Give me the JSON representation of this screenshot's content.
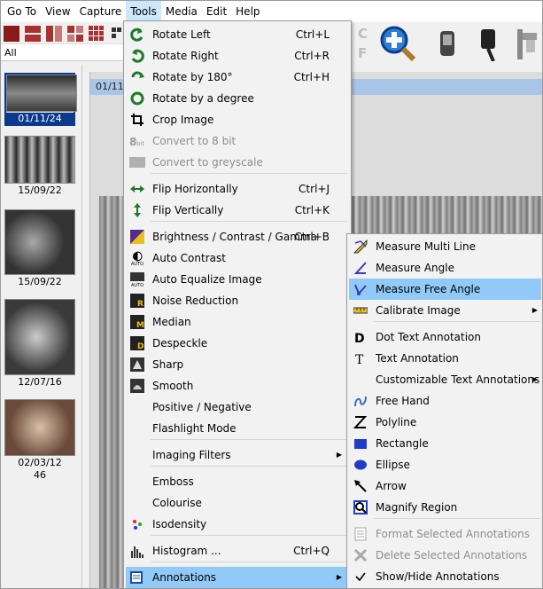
{
  "menubar": {
    "items": [
      {
        "label": "Go To"
      },
      {
        "label": "View"
      },
      {
        "label": "Capture"
      },
      {
        "label": "Tools"
      },
      {
        "label": "Media"
      },
      {
        "label": "Edit"
      },
      {
        "label": "Help"
      }
    ]
  },
  "toolbar": {
    "filter_value": "All",
    "cf_label_top": "C",
    "cf_label_bottom": "F"
  },
  "thumbnails": [
    {
      "label": "01/11/24",
      "selected": true
    },
    {
      "label": "15/09/22",
      "selected": false
    },
    {
      "label": "15/09/22",
      "selected": false
    },
    {
      "label": "12/07/16",
      "selected": false
    },
    {
      "label": "02/03/12",
      "extra": "46",
      "selected": false
    }
  ],
  "viewer": {
    "title": "01/11/"
  },
  "tools_menu": {
    "items": [
      {
        "label": "Rotate Left",
        "shortcut": "Ctrl+L",
        "icon": "rotate-left-icon"
      },
      {
        "label": "Rotate Right",
        "shortcut": "Ctrl+R",
        "icon": "rotate-right-icon"
      },
      {
        "label": "Rotate by 180°",
        "shortcut": "Ctrl+H",
        "icon": "rotate-180-icon"
      },
      {
        "label": "Rotate by a degree",
        "shortcut": "",
        "icon": "rotate-degree-icon"
      },
      {
        "label": "Crop Image",
        "shortcut": "",
        "icon": "crop-icon"
      },
      {
        "label": "Convert to 8 bit",
        "shortcut": "",
        "icon": "8bit-icon",
        "disabled": true
      },
      {
        "label": "Convert to greyscale",
        "shortcut": "",
        "icon": "greyscale-icon",
        "disabled": true
      },
      {
        "label": "Flip Horizontally",
        "shortcut": "Ctrl+J",
        "icon": "flip-horizontal-icon"
      },
      {
        "label": "Flip Vertically",
        "shortcut": "Ctrl+K",
        "icon": "flip-vertical-icon"
      },
      {
        "label": "Brightness / Contrast / Gamma",
        "shortcut": "Ctrl+B",
        "icon": "brightness-icon"
      },
      {
        "label": "Auto Contrast",
        "shortcut": "",
        "icon": "auto-contrast-icon"
      },
      {
        "label": "Auto Equalize Image",
        "shortcut": "",
        "icon": "auto-equalize-icon"
      },
      {
        "label": "Noise Reduction",
        "shortcut": "",
        "icon": "noise-reduction-icon"
      },
      {
        "label": "Median",
        "shortcut": "",
        "icon": "median-icon"
      },
      {
        "label": "Despeckle",
        "shortcut": "",
        "icon": "despeckle-icon"
      },
      {
        "label": "Sharp",
        "shortcut": "",
        "icon": "sharp-icon"
      },
      {
        "label": "Smooth",
        "shortcut": "",
        "icon": "smooth-icon"
      },
      {
        "label": "Positive / Negative",
        "shortcut": "",
        "icon": ""
      },
      {
        "label": "Flashlight Mode",
        "shortcut": "",
        "icon": ""
      },
      {
        "label": "Imaging Filters",
        "shortcut": "",
        "icon": "",
        "submenu": true
      },
      {
        "label": "Emboss",
        "shortcut": "",
        "icon": ""
      },
      {
        "label": "Colourise",
        "shortcut": "",
        "icon": ""
      },
      {
        "label": "Isodensity",
        "shortcut": "",
        "icon": "isodensity-icon"
      },
      {
        "label": "Histogram ...",
        "shortcut": "Ctrl+Q",
        "icon": "histogram-icon"
      },
      {
        "label": "Annotations",
        "shortcut": "",
        "icon": "annotations-icon",
        "submenu": true,
        "highlighted": true
      }
    ]
  },
  "annotations_menu": {
    "items": [
      {
        "label": "Measure Multi Line",
        "icon": "measure-multi-line-icon"
      },
      {
        "label": "Measure Angle",
        "icon": "measure-angle-icon"
      },
      {
        "label": "Measure Free Angle",
        "icon": "measure-free-angle-icon",
        "highlighted": true
      },
      {
        "label": "Calibrate Image",
        "icon": "calibrate-icon",
        "submenu": true
      },
      {
        "label": "Dot Text Annotation",
        "icon": "dot-text-icon"
      },
      {
        "label": "Text Annotation",
        "icon": "text-icon"
      },
      {
        "label": "Customizable Text Annotations",
        "icon": "",
        "submenu": true
      },
      {
        "label": "Free Hand",
        "icon": "free-hand-icon"
      },
      {
        "label": "Polyline",
        "icon": "polyline-icon"
      },
      {
        "label": "Rectangle",
        "icon": "rectangle-icon"
      },
      {
        "label": "Ellipse",
        "icon": "ellipse-icon"
      },
      {
        "label": "Arrow",
        "icon": "arrow-icon"
      },
      {
        "label": "Magnify Region",
        "icon": "magnify-region-icon"
      },
      {
        "label": "Format Selected Annotations",
        "icon": "format-annotations-icon",
        "disabled": true
      },
      {
        "label": "Delete Selected Annotations",
        "icon": "delete-annotations-icon",
        "disabled": true
      },
      {
        "label": "Show/Hide Annotations",
        "icon": "checkmark-icon"
      }
    ]
  },
  "colors": {
    "selection_blue": "#0b3a8c",
    "highlight": "#91c9f7",
    "menu_bg": "#f2f2f2"
  }
}
